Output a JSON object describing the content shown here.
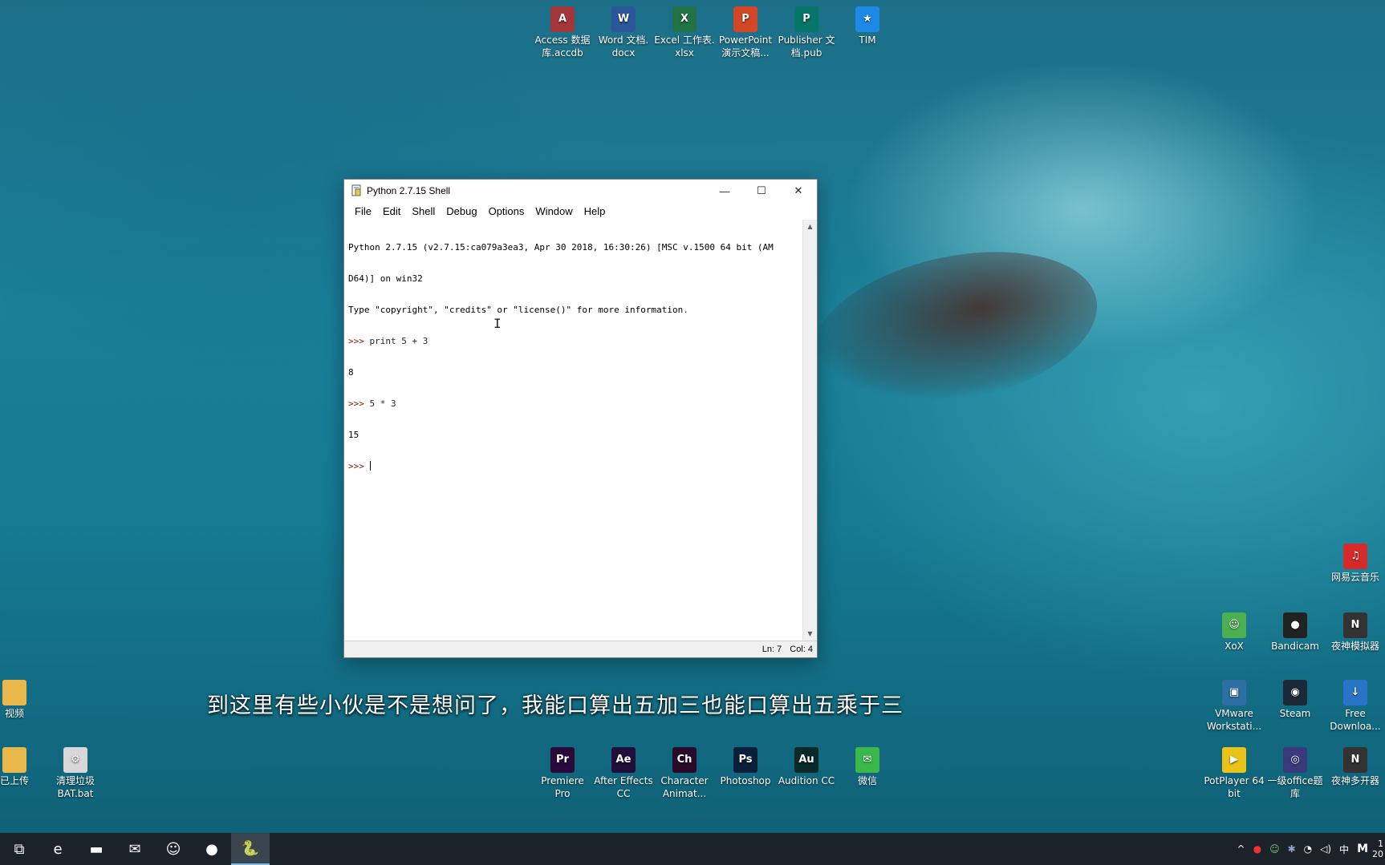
{
  "desktop": {
    "top_icons": [
      {
        "label": "Access 数据\n库.accdb",
        "icon": "access-icon",
        "color": "#a4373a",
        "glyph": "A"
      },
      {
        "label": "Word 文档.\ndocx",
        "icon": "word-icon",
        "color": "#2b579a",
        "glyph": "W"
      },
      {
        "label": "Excel 工作表.\nxlsx",
        "icon": "excel-icon",
        "color": "#217346",
        "glyph": "X"
      },
      {
        "label": "PowerPoint\n演示文稿...",
        "icon": "powerpoint-icon",
        "color": "#d24726",
        "glyph": "P"
      },
      {
        "label": "Publisher 文\n档.pub",
        "icon": "publisher-icon",
        "color": "#077568",
        "glyph": "P"
      },
      {
        "label": "TIM",
        "icon": "tim-icon",
        "color": "#1e88e5",
        "glyph": "★"
      }
    ],
    "left_icons": [
      {
        "label": "视频",
        "icon": "folder-icon",
        "color": "#e8b84a",
        "glyph": ""
      },
      {
        "label": "已上传",
        "icon": "folder-icon",
        "color": "#e8b84a",
        "glyph": ""
      },
      {
        "label": "清理垃圾\nBAT.bat",
        "icon": "gear-icon",
        "color": "#d8d8d8",
        "glyph": "⚙"
      }
    ],
    "bottom_icons": [
      {
        "label": "Premiere\nPro",
        "icon": "premiere-icon",
        "color": "#2a0a3a",
        "glyph": "Pr"
      },
      {
        "label": "After Effects\nCC",
        "icon": "after-effects-icon",
        "color": "#1f0f3a",
        "glyph": "Ae"
      },
      {
        "label": "Character\nAnimat...",
        "icon": "character-animator-icon",
        "color": "#2a0a2a",
        "glyph": "Ch"
      },
      {
        "label": "Photoshop",
        "icon": "photoshop-icon",
        "color": "#0a1f3a",
        "glyph": "Ps"
      },
      {
        "label": "Audition CC",
        "icon": "audition-icon",
        "color": "#0a2a2a",
        "glyph": "Au"
      },
      {
        "label": "微信",
        "icon": "wechat-icon",
        "color": "#3bb84a",
        "glyph": "✉"
      }
    ],
    "right_icons": [
      {
        "label": "网易云音乐",
        "icon": "netease-music-icon",
        "color": "#d62b2b",
        "glyph": "♫"
      },
      {
        "label": "XoX",
        "icon": "xox-icon",
        "color": "#4caf50",
        "glyph": "☺"
      },
      {
        "label": "Bandicam",
        "icon": "bandicam-icon",
        "color": "#222222",
        "glyph": "●"
      },
      {
        "label": "夜神模拟器",
        "icon": "nox-icon",
        "color": "#333333",
        "glyph": "N"
      },
      {
        "label": "VMware\nWorkstati...",
        "icon": "vmware-icon",
        "color": "#2d6fa3",
        "glyph": "▣"
      },
      {
        "label": "Steam",
        "icon": "steam-icon",
        "color": "#1b2838",
        "glyph": "◉"
      },
      {
        "label": "Free\nDownloa...",
        "icon": "free-download-icon",
        "color": "#2a74c7",
        "glyph": "↓"
      },
      {
        "label": "PotPlayer 64\nbit",
        "icon": "potplayer-icon",
        "color": "#e8c41a",
        "glyph": "▶"
      },
      {
        "label": "一级office题\n库",
        "icon": "office-quiz-icon",
        "color": "#3a3a7a",
        "glyph": "◎"
      },
      {
        "label": "夜神多开器",
        "icon": "nox-multi-icon",
        "color": "#333333",
        "glyph": "N"
      }
    ]
  },
  "window": {
    "title": "Python 2.7.15 Shell",
    "minimize": "—",
    "maximize": "☐",
    "close": "✕",
    "menu": [
      "File",
      "Edit",
      "Shell",
      "Debug",
      "Options",
      "Window",
      "Help"
    ],
    "shell_lines": [
      "Python 2.7.15 (v2.7.15:ca079a3ea3, Apr 30 2018, 16:30:26) [MSC v.1500 64 bit (AM",
      "D64)] on win32",
      "Type \"copyright\", \"credits\" or \"license()\" for more information."
    ],
    "session": [
      {
        "prompt": ">>> ",
        "code": "print 5 + 3"
      },
      {
        "output": "8"
      },
      {
        "prompt": ">>> ",
        "code": "5 * 3"
      },
      {
        "output": "15"
      },
      {
        "prompt": ">>> ",
        "code": ""
      }
    ],
    "status": {
      "line": "Ln: 7",
      "col": "Col: 4"
    }
  },
  "subtitle": "到这里有些小伙是不是想问了，我能口算出五加三也能口算出五乘于三",
  "taskbar": {
    "buttons": [
      {
        "name": "task-view-icon",
        "glyph": "⧉"
      },
      {
        "name": "edge-icon",
        "glyph": "e"
      },
      {
        "name": "file-explorer-icon",
        "glyph": "▬"
      },
      {
        "name": "mail-icon",
        "glyph": "✉"
      },
      {
        "name": "xox-taskbar-icon",
        "glyph": "☺"
      },
      {
        "name": "record-icon",
        "glyph": "●"
      },
      {
        "name": "python-idle-icon",
        "glyph": "🐍"
      }
    ],
    "tray": {
      "chevron": "^",
      "ime": "中",
      "letter": "M",
      "clock_line1": "1",
      "clock_line2": "20"
    }
  }
}
